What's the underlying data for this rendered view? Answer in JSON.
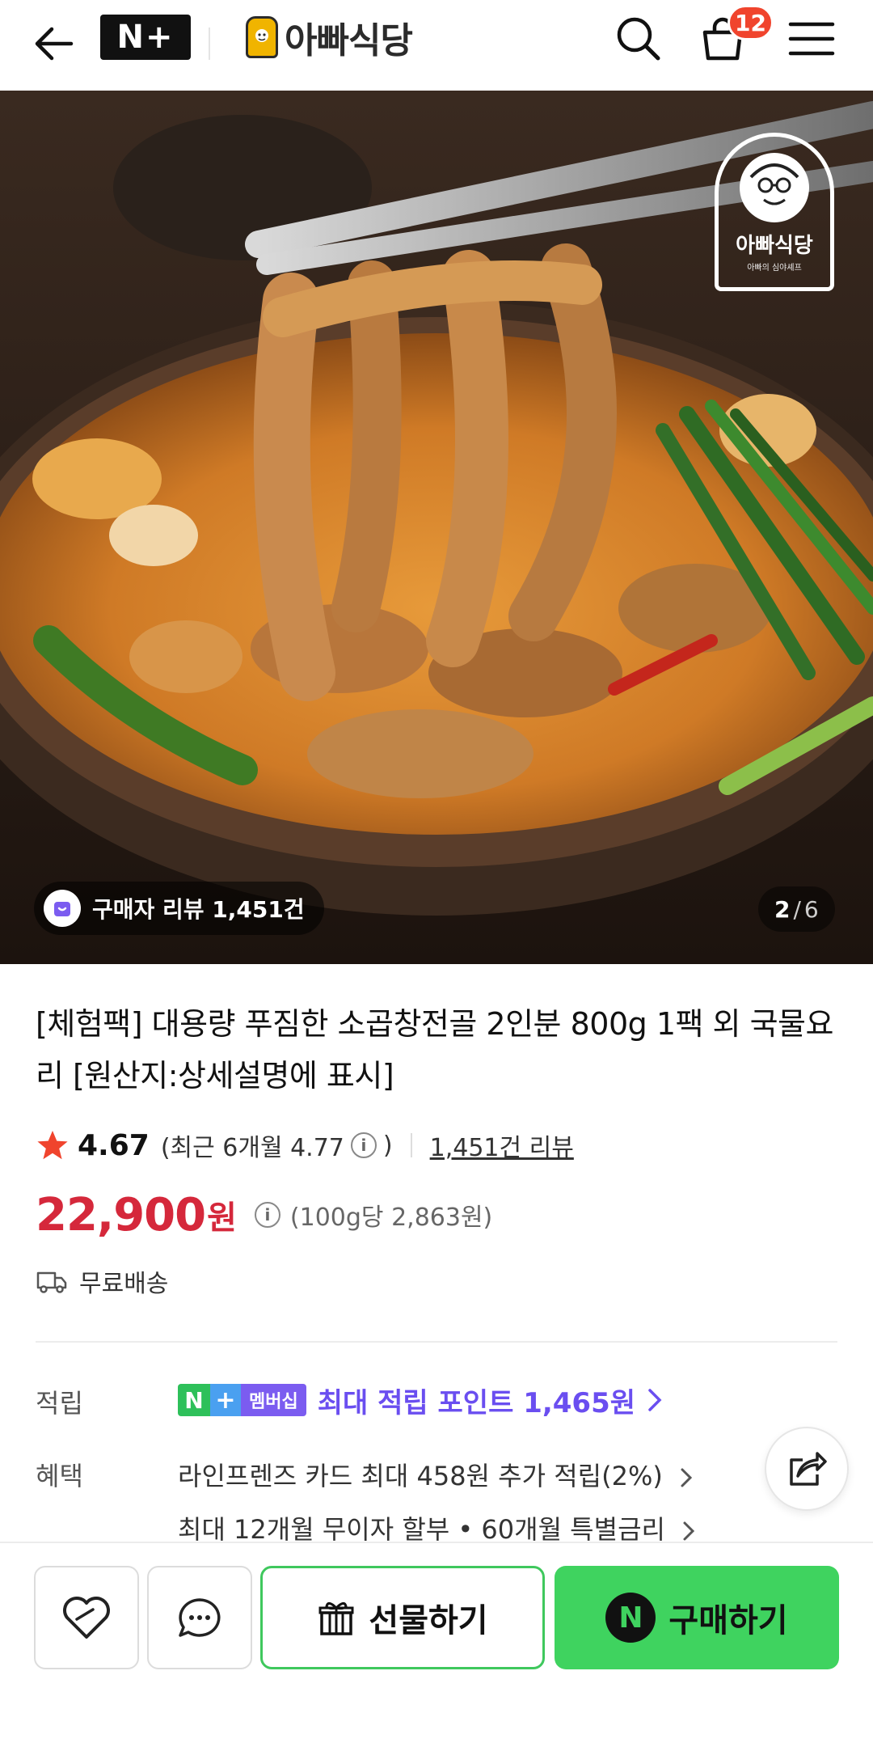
{
  "header": {
    "nplus_label": "N+",
    "brand_name": "아빠식당",
    "cart_count": "12"
  },
  "hero": {
    "review_chip": "구매자 리뷰 1,451건",
    "pager_current": "2",
    "pager_separator": "/",
    "pager_total": "6",
    "store_badge_name": "아빠식당",
    "store_badge_sub": "아빠의 심야셰프"
  },
  "product": {
    "title": "[체험팩] 대용량 푸짐한 소곱창전골 2인분 800g 1팩 외 국물요리 [원산지:상세설명에 표시]",
    "rating": "4.67",
    "recent_rating_open": "(최근 6개월 4.77",
    "recent_rating_close": ")",
    "review_link": "1,451건 리뷰",
    "price": "22,900",
    "price_unit": "원",
    "unit_price": "(100g당 2,863원)",
    "shipping": "무료배송"
  },
  "benefits": {
    "points_label": "적립",
    "membership_n": "N",
    "membership_plus": "+",
    "membership_text": "멤버십",
    "points_text": "최대 적립 포인트 1,465원",
    "benefit_label": "혜택",
    "benefit_1": "라인프렌즈 카드 최대 458원 추가 적립(2%)",
    "benefit_2": "최대 12개월 무이자 할부 • 60개월 특별금리"
  },
  "bottom_bar": {
    "gift_label": "선물하기",
    "buy_n": "N",
    "buy_label": "구매하기"
  },
  "colors": {
    "price_red": "#d5283b",
    "points_purple": "#6a4ef0",
    "buy_green": "#3fd35f",
    "badge_red": "#f0442d"
  }
}
